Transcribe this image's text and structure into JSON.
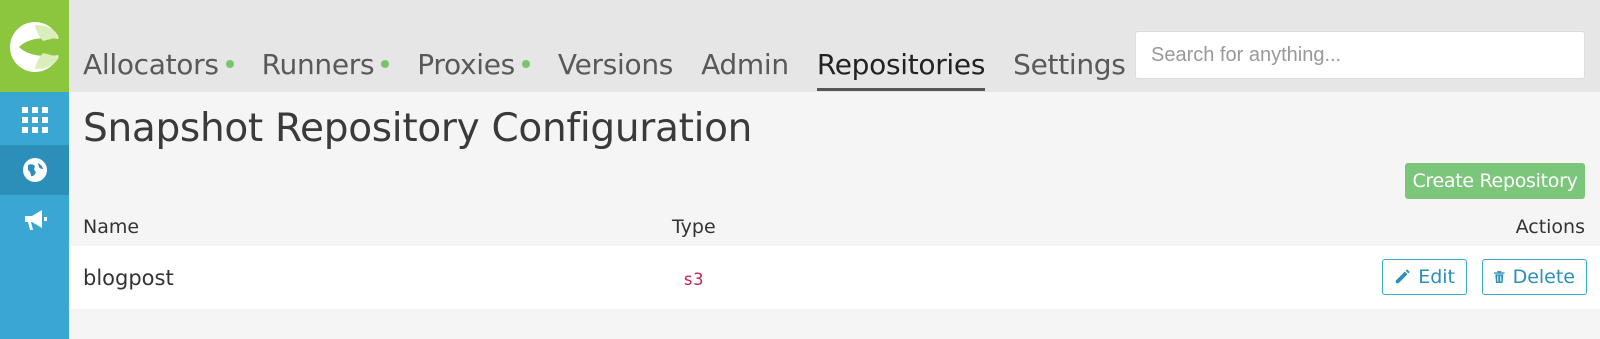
{
  "nav": {
    "items": [
      {
        "label": "Allocators",
        "status": "green"
      },
      {
        "label": "Runners",
        "status": "green"
      },
      {
        "label": "Proxies",
        "status": "green"
      },
      {
        "label": "Versions"
      },
      {
        "label": "Admin"
      },
      {
        "label": "Repositories",
        "active": true
      },
      {
        "label": "Settings"
      }
    ]
  },
  "search": {
    "placeholder": "Search for anything..."
  },
  "sidebar": {
    "icons": [
      "apps-grid-icon",
      "globe-icon",
      "megaphone-icon"
    ],
    "active_index": 1
  },
  "page": {
    "title": "Snapshot Repository Configuration"
  },
  "toolbar": {
    "create_label": "Create Repository"
  },
  "table": {
    "headers": {
      "name": "Name",
      "type": "Type",
      "actions": "Actions"
    },
    "rows": [
      {
        "name": "blogpost",
        "type": "s3",
        "edit_label": "Edit",
        "delete_label": "Delete"
      }
    ]
  },
  "colors": {
    "sidebar": "#3aa7d3",
    "logo_bg": "#8cc63f",
    "status_dot": "#7ac36a",
    "create_button": "#7cc67c",
    "type_text": "#c7254e"
  }
}
